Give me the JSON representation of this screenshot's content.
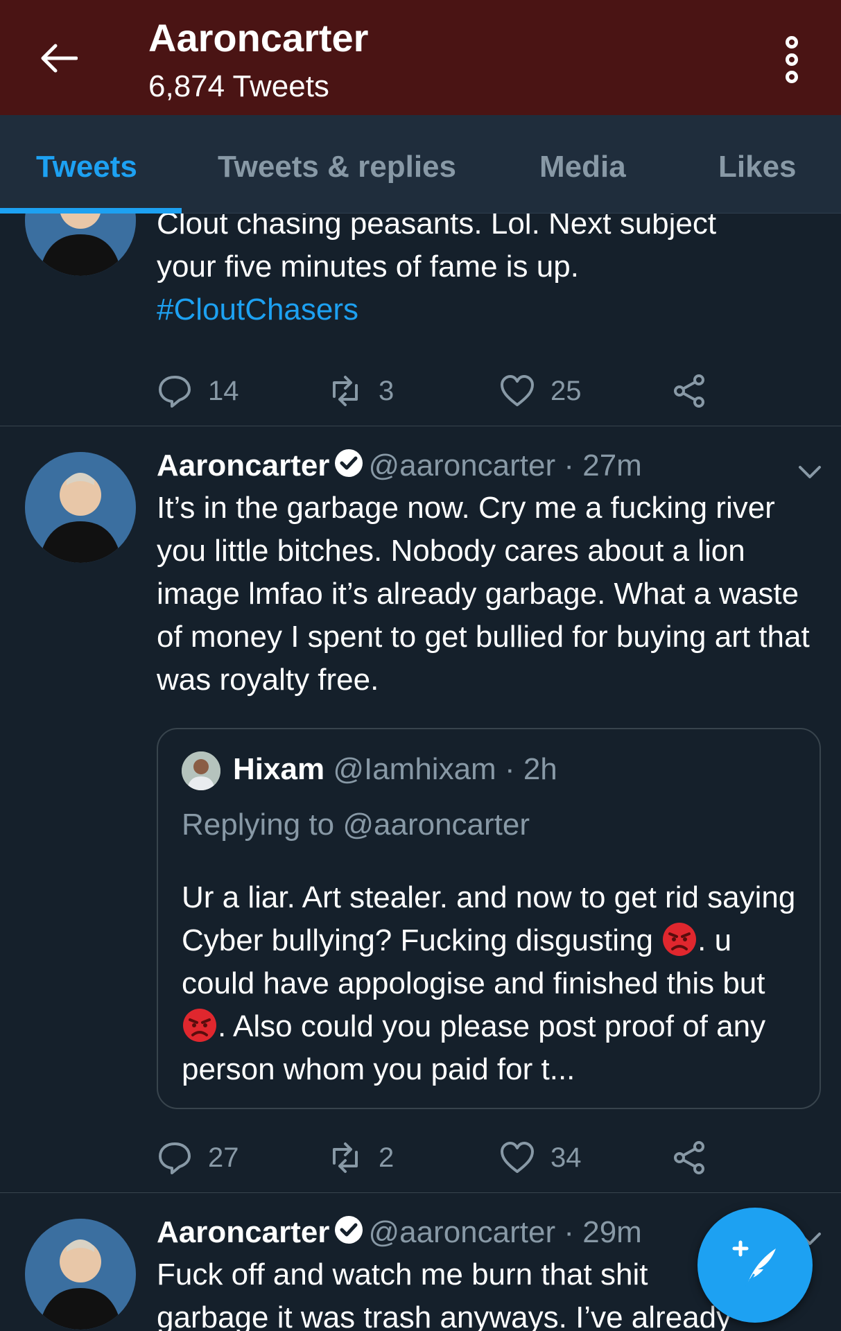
{
  "header": {
    "title": "Aaroncarter",
    "subtitle": "6,874 Tweets"
  },
  "tabs": [
    {
      "label": "Tweets",
      "active": true
    },
    {
      "label": "Tweets & replies",
      "active": false
    },
    {
      "label": "Media",
      "active": false
    },
    {
      "label": "Likes",
      "active": false
    }
  ],
  "tweets": [
    {
      "text_lines": [
        "Clout chasing peasants. Lol. Next subject",
        "your five minutes of fame is up."
      ],
      "hashtag": "#CloutChasers",
      "replies": "14",
      "retweets": "3",
      "likes": "25"
    },
    {
      "name": "Aaroncarter",
      "handle": "@aaroncarter",
      "time": "· 27m",
      "text": "It’s in the garbage now. Cry me a fucking river you little bitches. Nobody cares about a lion image lmfao it’s already garbage. What a waste of money I spent to get bullied for buying art that was royalty free.",
      "quote": {
        "name": "Hixam",
        "handle": "@Iamhixam",
        "time": "· 2h",
        "replying_to": "Replying to @aaroncarter",
        "text_part1": "Ur a liar. Art stealer. and now to get rid saying Cyber bullying? Fucking disgusting ",
        "text_part2": ". u could have appologise and finished this but ",
        "text_part3": ". Also could you please post proof of any person whom you paid for t..."
      },
      "replies": "27",
      "retweets": "2",
      "likes": "34"
    },
    {
      "name": "Aaroncarter",
      "handle": "@aaroncarter",
      "time": "· 29m",
      "text_lines": [
        "Fuck off and watch me burn that shit",
        "garbage it was trash anyways. I’ve already"
      ]
    }
  ],
  "colors": {
    "header_bg": "#4a1414",
    "accent": "#1da1f2",
    "background": "#15202b",
    "muted_text": "#8899a6"
  }
}
